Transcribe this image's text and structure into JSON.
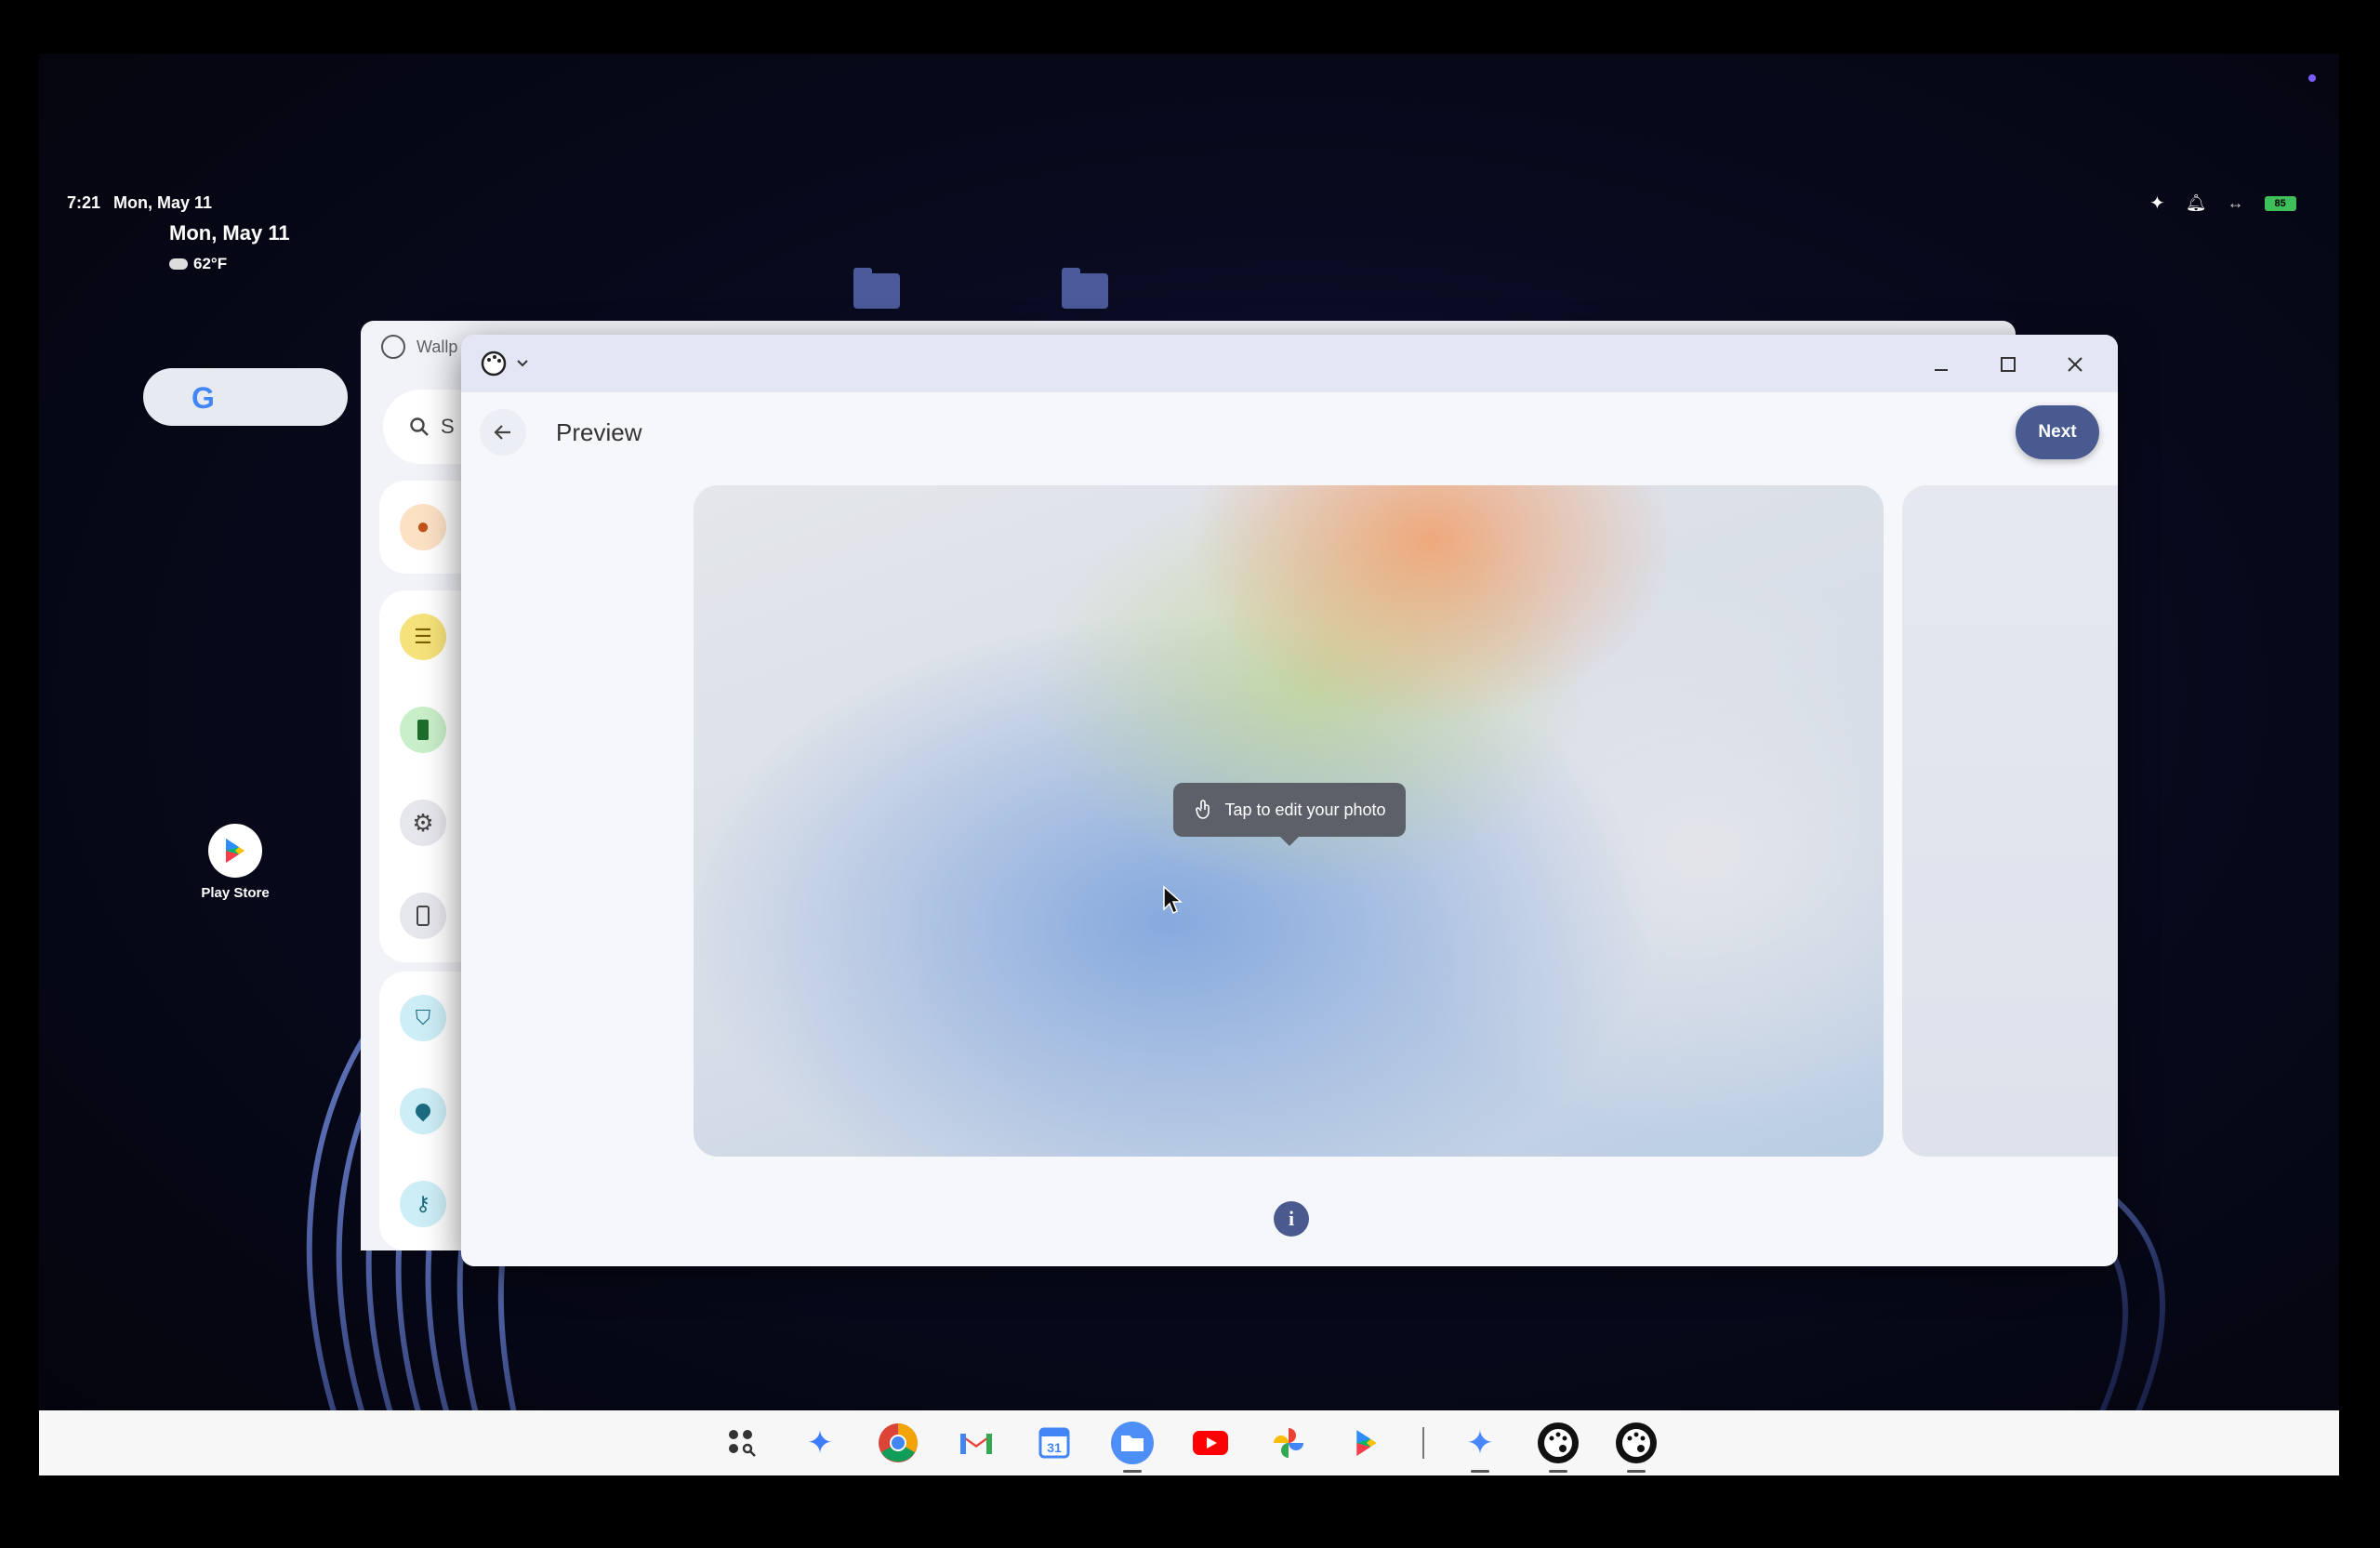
{
  "status_bar": {
    "time": "7:21",
    "date": "Mon, May 11",
    "battery": "85"
  },
  "date_widget": {
    "date": "Mon, May 11",
    "weather": "62°F"
  },
  "desktop": {
    "play_store_label": "Play Store"
  },
  "settings_window": {
    "title": "Wallp",
    "search_placeholder": "S"
  },
  "wallpaper_window": {
    "toolbar_title": "Preview",
    "next_label": "Next",
    "tooltip": "Tap to edit your photo",
    "info_label": "i"
  },
  "colors": {
    "accent": "#485a8f",
    "shelf_bg": "#f7f7f8",
    "recording": "#7b5cff"
  }
}
